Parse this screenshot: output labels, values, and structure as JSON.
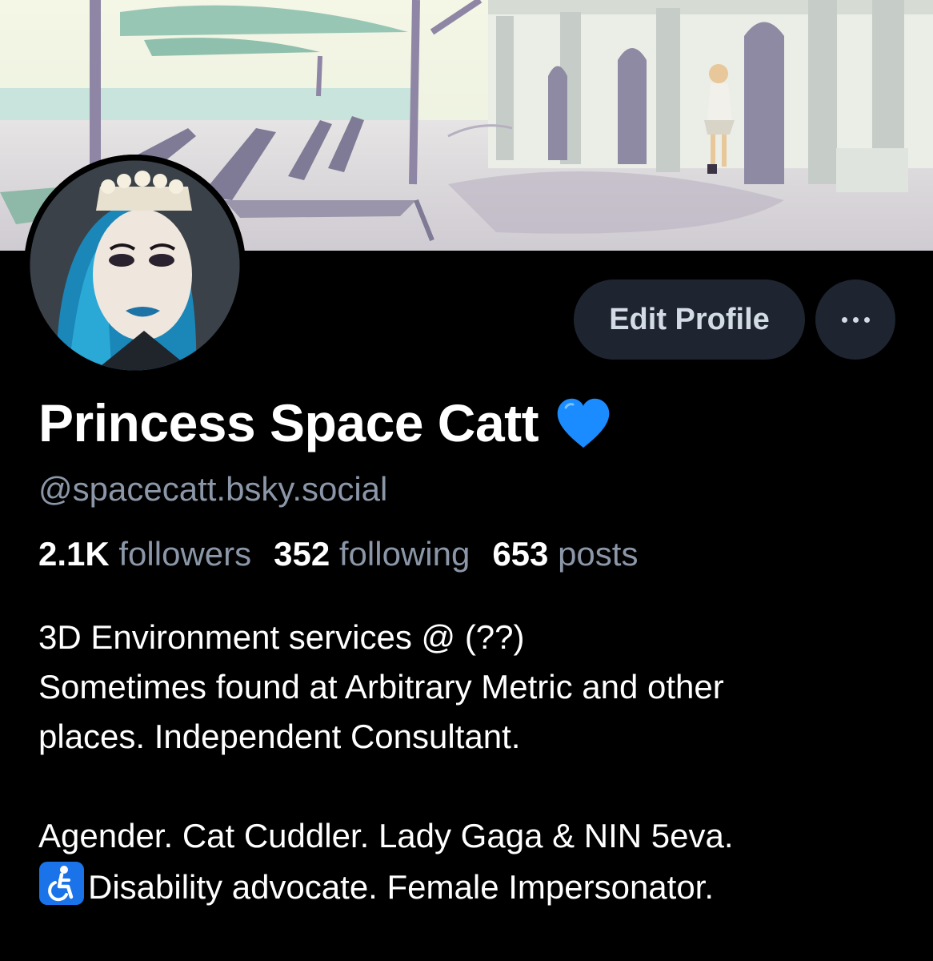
{
  "profile": {
    "display_name": "Princess Space Catt",
    "name_emoji": "blue-heart-icon",
    "handle": "@spacecatt.bsky.social"
  },
  "actions": {
    "edit_label": "Edit Profile",
    "more_icon": "ellipsis-icon"
  },
  "stats": {
    "followers_count": "2.1K",
    "followers_label": "followers",
    "following_count": "352",
    "following_label": "following",
    "posts_count": "653",
    "posts_label": "posts"
  },
  "bio": {
    "line1": "3D Environment services @ (??)",
    "line2": "Sometimes found at Arbitrary Metric and other",
    "line3": "places. Independent Consultant.",
    "line4": "Agender. Cat Cuddler. Lady Gaga & NIN 5eva.",
    "line5": "Disability advocate. Female Impersonator.",
    "line5_icon": "wheelchair-accessibility-icon"
  },
  "colors": {
    "background": "#000000",
    "button_bg": "#1e2530",
    "button_text": "#d3dbe5",
    "muted_text": "#8b97a8",
    "heart": "#1a8cff",
    "a11y_badge": "#1a73e8"
  }
}
